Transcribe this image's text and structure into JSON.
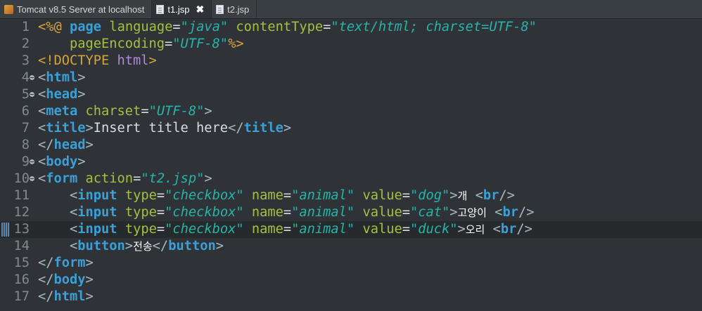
{
  "tabs": [
    {
      "label": "Tomcat v8.5 Server at localhost",
      "icon": "server-icon",
      "active": false
    },
    {
      "label": "t1.jsp",
      "icon": "jsp-file-icon",
      "active": true,
      "close": "✖"
    },
    {
      "label": "t2.jsp",
      "icon": "jsp-file-icon",
      "active": false
    }
  ],
  "editor": {
    "current_line": 13,
    "lines": [
      {
        "n": "1",
        "tokens": [
          {
            "c": "jd",
            "t": "<%@"
          },
          {
            "c": "t",
            "t": " "
          },
          {
            "c": "kw",
            "t": "page"
          },
          {
            "c": "t",
            "t": " "
          },
          {
            "c": "at",
            "t": "language"
          },
          {
            "c": "t",
            "t": "="
          },
          {
            "c": "st",
            "t": "\"java\""
          },
          {
            "c": "t",
            "t": " "
          },
          {
            "c": "at",
            "t": "contentType"
          },
          {
            "c": "t",
            "t": "="
          },
          {
            "c": "st",
            "t": "\"text/html; charset=UTF-8\""
          }
        ]
      },
      {
        "n": "2",
        "tokens": [
          {
            "c": "t",
            "t": "    "
          },
          {
            "c": "at",
            "t": "pageEncoding"
          },
          {
            "c": "t",
            "t": "="
          },
          {
            "c": "st",
            "t": "\"UTF-8\""
          },
          {
            "c": "jd",
            "t": "%>"
          }
        ]
      },
      {
        "n": "3",
        "tokens": [
          {
            "c": "jd",
            "t": "<!DOCTYPE"
          },
          {
            "c": "t",
            "t": " "
          },
          {
            "c": "dc",
            "t": "html"
          },
          {
            "c": "jd",
            "t": ">"
          }
        ]
      },
      {
        "n": "4",
        "fold": true,
        "tokens": [
          {
            "c": "b",
            "t": "<"
          },
          {
            "c": "kw",
            "t": "html"
          },
          {
            "c": "b",
            "t": ">"
          }
        ]
      },
      {
        "n": "5",
        "fold": true,
        "tokens": [
          {
            "c": "b",
            "t": "<"
          },
          {
            "c": "kw",
            "t": "head"
          },
          {
            "c": "b",
            "t": ">"
          }
        ]
      },
      {
        "n": "6",
        "tokens": [
          {
            "c": "b",
            "t": "<"
          },
          {
            "c": "kw",
            "t": "meta"
          },
          {
            "c": "t",
            "t": " "
          },
          {
            "c": "at",
            "t": "charset"
          },
          {
            "c": "t",
            "t": "="
          },
          {
            "c": "st",
            "t": "\"UTF-8\""
          },
          {
            "c": "b",
            "t": ">"
          }
        ]
      },
      {
        "n": "7",
        "tokens": [
          {
            "c": "b",
            "t": "<"
          },
          {
            "c": "kw",
            "t": "title"
          },
          {
            "c": "b",
            "t": ">"
          },
          {
            "c": "t",
            "t": "Insert title here"
          },
          {
            "c": "b",
            "t": "</"
          },
          {
            "c": "kw",
            "t": "title"
          },
          {
            "c": "b",
            "t": ">"
          }
        ]
      },
      {
        "n": "8",
        "tokens": [
          {
            "c": "b",
            "t": "</"
          },
          {
            "c": "kw",
            "t": "head"
          },
          {
            "c": "b",
            "t": ">"
          }
        ]
      },
      {
        "n": "9",
        "fold": true,
        "tokens": [
          {
            "c": "b",
            "t": "<"
          },
          {
            "c": "kw",
            "t": "body"
          },
          {
            "c": "b",
            "t": ">"
          }
        ]
      },
      {
        "n": "10",
        "fold": true,
        "tokens": [
          {
            "c": "b",
            "t": "<"
          },
          {
            "c": "kw",
            "t": "form"
          },
          {
            "c": "t",
            "t": " "
          },
          {
            "c": "at",
            "t": "action"
          },
          {
            "c": "t",
            "t": "="
          },
          {
            "c": "st",
            "t": "\"t2.jsp\""
          },
          {
            "c": "b",
            "t": ">"
          }
        ]
      },
      {
        "n": "11",
        "tokens": [
          {
            "c": "t",
            "t": "    "
          },
          {
            "c": "b",
            "t": "<"
          },
          {
            "c": "kw",
            "t": "input"
          },
          {
            "c": "t",
            "t": " "
          },
          {
            "c": "at",
            "t": "type"
          },
          {
            "c": "t",
            "t": "="
          },
          {
            "c": "st",
            "t": "\"checkbox\""
          },
          {
            "c": "t",
            "t": " "
          },
          {
            "c": "at",
            "t": "name"
          },
          {
            "c": "t",
            "t": "="
          },
          {
            "c": "st",
            "t": "\"animal\""
          },
          {
            "c": "t",
            "t": " "
          },
          {
            "c": "at",
            "t": "value"
          },
          {
            "c": "t",
            "t": "="
          },
          {
            "c": "st",
            "t": "\"dog\""
          },
          {
            "c": "b",
            "t": ">"
          },
          {
            "c": "ko",
            "t": "개"
          },
          {
            "c": "t",
            "t": " "
          },
          {
            "c": "b",
            "t": "<"
          },
          {
            "c": "kw",
            "t": "br"
          },
          {
            "c": "b",
            "t": "/>"
          }
        ]
      },
      {
        "n": "12",
        "tokens": [
          {
            "c": "t",
            "t": "    "
          },
          {
            "c": "b",
            "t": "<"
          },
          {
            "c": "kw",
            "t": "input"
          },
          {
            "c": "t",
            "t": " "
          },
          {
            "c": "at",
            "t": "type"
          },
          {
            "c": "t",
            "t": "="
          },
          {
            "c": "st",
            "t": "\"checkbox\""
          },
          {
            "c": "t",
            "t": " "
          },
          {
            "c": "at",
            "t": "name"
          },
          {
            "c": "t",
            "t": "="
          },
          {
            "c": "st",
            "t": "\"animal\""
          },
          {
            "c": "t",
            "t": " "
          },
          {
            "c": "at",
            "t": "value"
          },
          {
            "c": "t",
            "t": "="
          },
          {
            "c": "st",
            "t": "\"cat\""
          },
          {
            "c": "b",
            "t": ">"
          },
          {
            "c": "ko",
            "t": "고양이"
          },
          {
            "c": "t",
            "t": " "
          },
          {
            "c": "b",
            "t": "<"
          },
          {
            "c": "kw",
            "t": "br"
          },
          {
            "c": "b",
            "t": "/>"
          }
        ]
      },
      {
        "n": "13",
        "marker": true,
        "tokens": [
          {
            "c": "t",
            "t": "    "
          },
          {
            "c": "b",
            "t": "<"
          },
          {
            "c": "kw",
            "t": "input"
          },
          {
            "c": "t",
            "t": " "
          },
          {
            "c": "at",
            "t": "type"
          },
          {
            "c": "t",
            "t": "="
          },
          {
            "c": "st",
            "t": "\"checkbox\""
          },
          {
            "c": "t",
            "t": " "
          },
          {
            "c": "at",
            "t": "name"
          },
          {
            "c": "t",
            "t": "="
          },
          {
            "c": "st",
            "t": "\"animal\""
          },
          {
            "c": "t",
            "t": " "
          },
          {
            "c": "at",
            "t": "value"
          },
          {
            "c": "t",
            "t": "="
          },
          {
            "c": "st",
            "t": "\"duck\""
          },
          {
            "c": "b",
            "t": ">"
          },
          {
            "c": "ko",
            "t": "오리"
          },
          {
            "c": "t",
            "t": " "
          },
          {
            "c": "b",
            "t": "<"
          },
          {
            "c": "kw",
            "t": "br"
          },
          {
            "c": "b",
            "t": "/>"
          }
        ]
      },
      {
        "n": "14",
        "tokens": [
          {
            "c": "t",
            "t": "    "
          },
          {
            "c": "b",
            "t": "<"
          },
          {
            "c": "kw",
            "t": "button"
          },
          {
            "c": "b",
            "t": ">"
          },
          {
            "c": "ko",
            "t": "전송"
          },
          {
            "c": "b",
            "t": "</"
          },
          {
            "c": "kw",
            "t": "button"
          },
          {
            "c": "b",
            "t": ">"
          }
        ]
      },
      {
        "n": "15",
        "tokens": [
          {
            "c": "b",
            "t": "</"
          },
          {
            "c": "kw",
            "t": "form"
          },
          {
            "c": "b",
            "t": ">"
          }
        ]
      },
      {
        "n": "16",
        "tokens": [
          {
            "c": "b",
            "t": "</"
          },
          {
            "c": "kw",
            "t": "body"
          },
          {
            "c": "b",
            "t": ">"
          }
        ]
      },
      {
        "n": "17",
        "tokens": [
          {
            "c": "b",
            "t": "</"
          },
          {
            "c": "kw",
            "t": "html"
          },
          {
            "c": "b",
            "t": ">"
          }
        ]
      }
    ]
  }
}
